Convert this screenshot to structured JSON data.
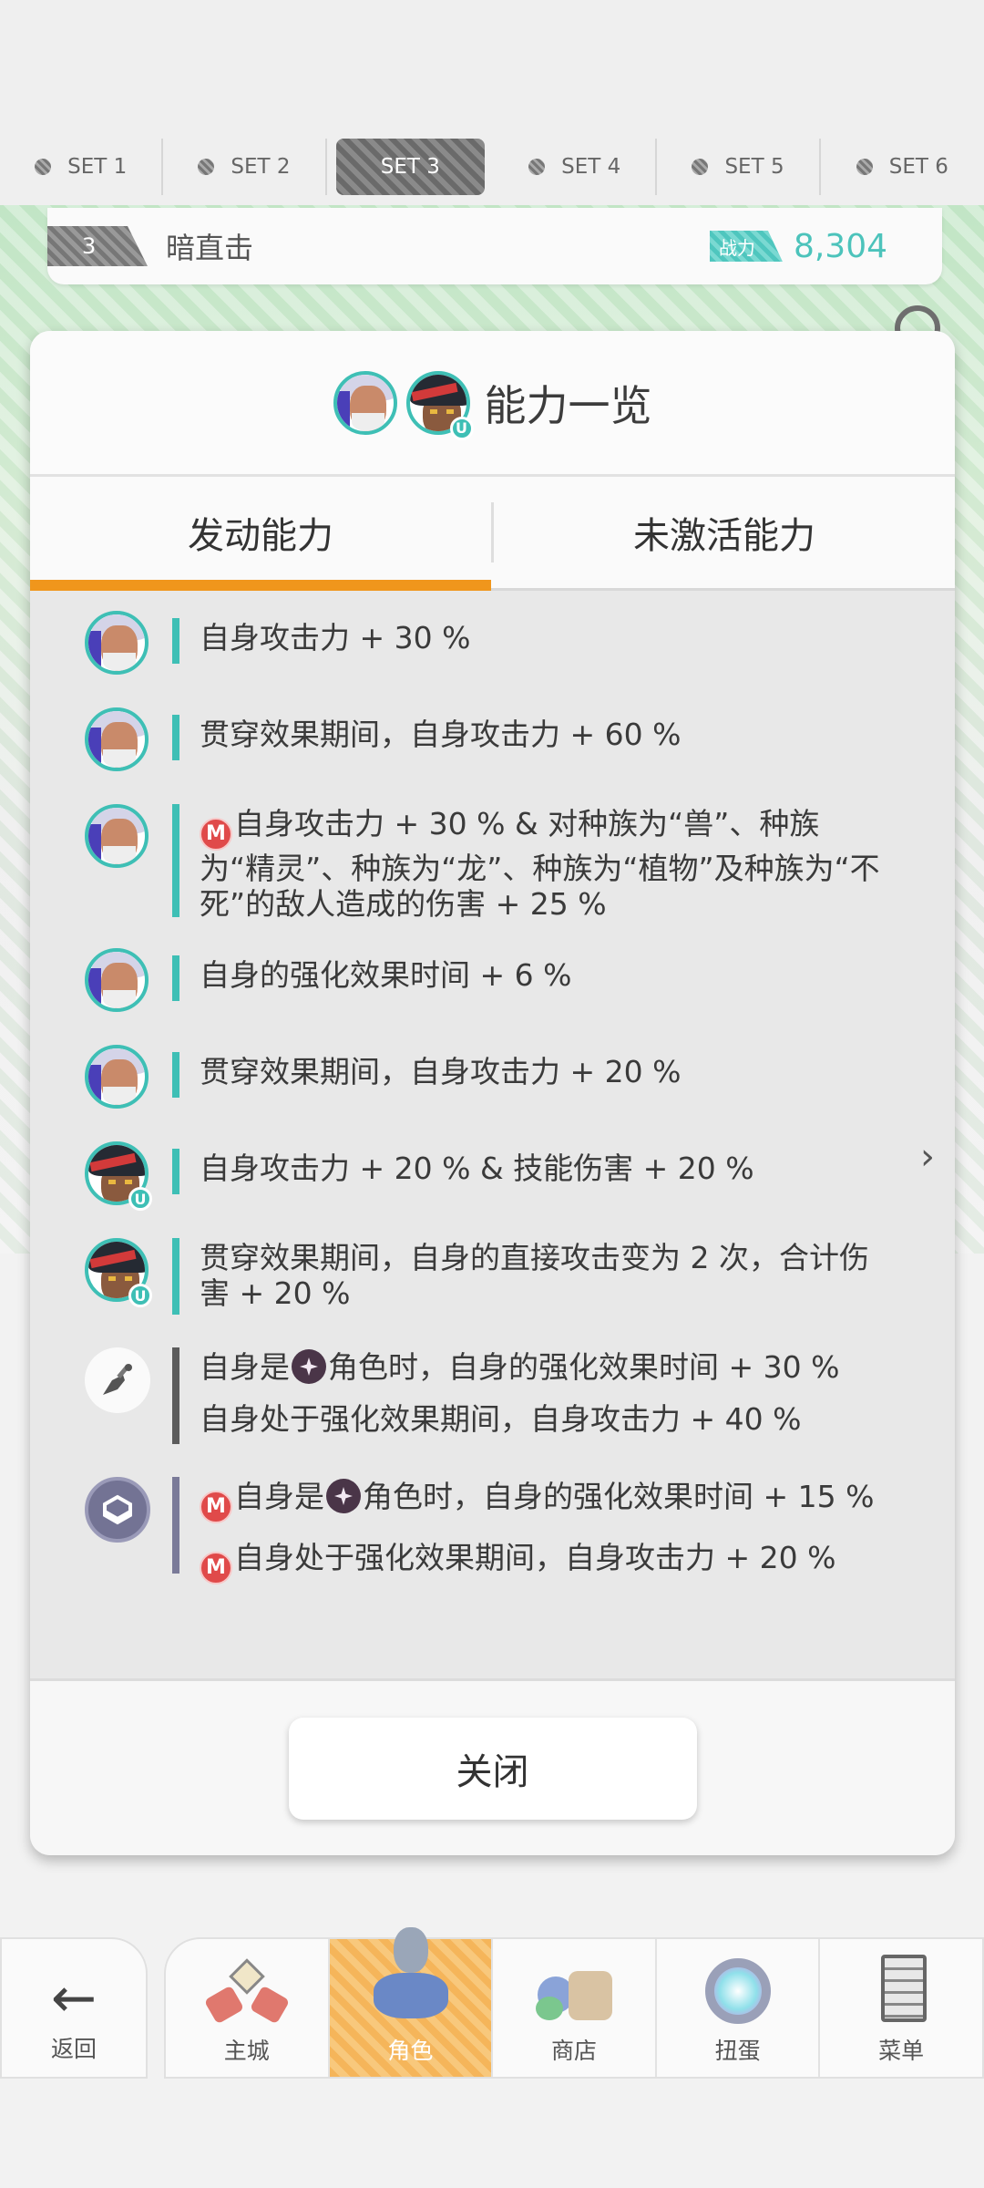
{
  "set_tabs": [
    {
      "label": "SET 1",
      "active": false
    },
    {
      "label": "SET 2",
      "active": false
    },
    {
      "label": "SET 3",
      "active": true
    },
    {
      "label": "SET 4",
      "active": false
    },
    {
      "label": "SET 5",
      "active": false
    },
    {
      "label": "SET 6",
      "active": false
    }
  ],
  "set_strip": {
    "number": "3",
    "name": "暗直击",
    "power_label": "战力",
    "power_value": "8,304"
  },
  "modal": {
    "title": "能力一览",
    "tabs": [
      {
        "label": "发动能力",
        "active": true
      },
      {
        "label": "未激活能力",
        "active": false
      }
    ],
    "abilities": [
      {
        "icon": "silver-hair-character-avatar-icon",
        "bar": "teal",
        "lines": [
          "自身攻击力 + 30 %"
        ]
      },
      {
        "icon": "silver-hair-character-avatar-icon",
        "bar": "teal",
        "lines": [
          "贯穿效果期间，自身攻击力 + 60 %"
        ]
      },
      {
        "icon": "silver-hair-character-avatar-icon",
        "bar": "teal",
        "m_badge": "M",
        "lines": [
          "自身攻击力 + 30 % & 对种族为“兽”、种族为“精灵”、种族为“龙”、种族为“植物”及种族为“不死”的敌人造成的伤害 + 25 %"
        ]
      },
      {
        "icon": "silver-hair-character-avatar-icon",
        "bar": "teal",
        "lines": [
          "自身的强化效果时间 + 6 %"
        ]
      },
      {
        "icon": "silver-hair-character-avatar-icon",
        "bar": "teal",
        "lines": [
          "贯穿效果期间，自身攻击力 + 20 %"
        ]
      },
      {
        "icon": "dark-hair-character-avatar-icon",
        "bar": "teal",
        "u_badge": "U",
        "lines": [
          "自身攻击力 + 20 % & 技能伤害 + 20 %"
        ]
      },
      {
        "icon": "dark-hair-character-avatar-icon",
        "bar": "teal",
        "u_badge": "U",
        "lines": [
          "贯穿效果期间，自身的直接攻击变为 2 次，合计伤害 + 20 %"
        ]
      },
      {
        "icon": "shovel-weapon-icon",
        "bar": "dark",
        "lines_rich": [
          {
            "pre": "自身是",
            "type_icon": true,
            "post": "角色时，自身的强化效果时间 + 30 %"
          },
          {
            "pre": "",
            "type_icon": false,
            "post": "自身处于强化效果期间，自身攻击力 + 40 %"
          }
        ]
      },
      {
        "icon": "armor-emblem-icon",
        "bar": "purple",
        "lines_rich": [
          {
            "m_badge": "M",
            "pre": "自身是",
            "type_icon": true,
            "post": "角色时，自身的强化效果时间 + 15 %"
          },
          {
            "m_badge": "M",
            "pre": "",
            "type_icon": false,
            "post": "自身处于强化效果期间，自身攻击力 + 20 %"
          }
        ]
      }
    ],
    "close_label": "关闭",
    "next_glyph": "›"
  },
  "nav": {
    "back_label": "返回",
    "items": [
      {
        "label": "主城",
        "icon": "castle-icon",
        "active": false
      },
      {
        "label": "角色",
        "icon": "character-icon",
        "active": true
      },
      {
        "label": "商店",
        "icon": "shop-icon",
        "active": false
      },
      {
        "label": "扭蛋",
        "icon": "gacha-icon",
        "active": false
      },
      {
        "label": "菜单",
        "icon": "menu-icon",
        "active": false
      }
    ]
  },
  "colors": {
    "accent_orange": "#f0961c",
    "teal": "#3ebfb5",
    "power_teal": "#4cc3bb"
  }
}
